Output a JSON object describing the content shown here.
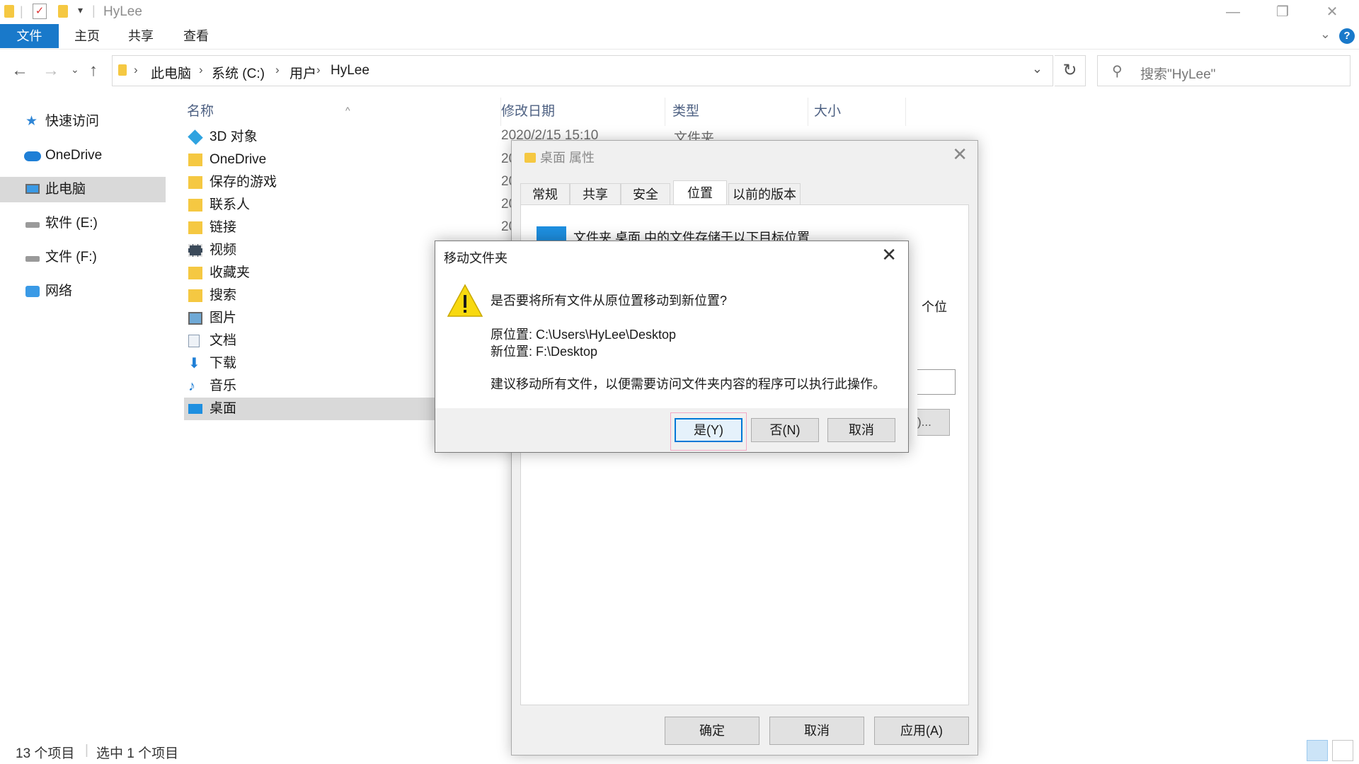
{
  "window": {
    "title": "HyLee",
    "minimize_glyph": "—",
    "restore_glyph": "❐",
    "close_glyph": "✕"
  },
  "ribbon": {
    "tabs": [
      "文件",
      "主页",
      "共享",
      "查看"
    ],
    "help_glyph": "?"
  },
  "address": {
    "crumbs": [
      "此电脑",
      "系统 (C:)",
      "用户",
      "HyLee"
    ],
    "search_placeholder": "搜索\"HyLee\""
  },
  "sidebar": {
    "items": [
      {
        "label": "快速访问",
        "icon": "star-icon"
      },
      {
        "label": "OneDrive",
        "icon": "cloud-icon"
      },
      {
        "label": "此电脑",
        "icon": "computer-icon",
        "selected": true
      },
      {
        "label": "软件 (E:)",
        "icon": "drive-icon"
      },
      {
        "label": "文件 (F:)",
        "icon": "drive-icon"
      },
      {
        "label": "网络",
        "icon": "network-icon"
      }
    ]
  },
  "filelist": {
    "columns": [
      "名称",
      "修改日期",
      "类型",
      "大小"
    ],
    "first_date": "2020/2/15 15:10",
    "date_prefix": "20",
    "first_type": "文件夹",
    "rows": [
      {
        "label": "3D 对象",
        "icon": "cube-icon"
      },
      {
        "label": "OneDrive",
        "icon": "onedrive-folder-icon"
      },
      {
        "label": "保存的游戏",
        "icon": "saved-games-icon"
      },
      {
        "label": "联系人",
        "icon": "contacts-icon"
      },
      {
        "label": "链接",
        "icon": "links-icon"
      },
      {
        "label": "视频",
        "icon": "video-icon"
      },
      {
        "label": "收藏夹",
        "icon": "favorites-icon"
      },
      {
        "label": "搜索",
        "icon": "search-folder-icon"
      },
      {
        "label": "图片",
        "icon": "pictures-icon"
      },
      {
        "label": "文档",
        "icon": "documents-icon"
      },
      {
        "label": "下载",
        "icon": "download-icon"
      },
      {
        "label": "音乐",
        "icon": "music-icon"
      },
      {
        "label": "桌面",
        "icon": "desktop-icon",
        "selected": true
      }
    ]
  },
  "statusbar": {
    "count": "13 个项目",
    "selected": "选中 1 个项目"
  },
  "properties": {
    "title": "桌面 属性",
    "tabs": [
      "常规",
      "共享",
      "安全",
      "位置",
      "以前的版本"
    ],
    "active_tab": "位置",
    "line1": "文件夹 桌面 中的文件存储于以下目标位置",
    "peek_text": "个位",
    "button_peek": ")...",
    "buttons": [
      "确定",
      "取消",
      "应用(A)"
    ]
  },
  "move_dialog": {
    "title": "移动文件夹",
    "question": "是否要将所有文件从原位置移动到新位置?",
    "old_location": "原位置: C:\\Users\\HyLee\\Desktop",
    "new_location": "新位置: F:\\Desktop",
    "advice": "建议移动所有文件，以便需要访问文件夹内容的程序可以执行此操作。",
    "buttons": {
      "yes": "是(Y)",
      "no": "否(N)",
      "cancel": "取消"
    }
  },
  "colors": {
    "accent": "#1979ca",
    "selection": "#d9d9d9",
    "warning": "#f8d90f",
    "header_text": "#4d6082"
  }
}
